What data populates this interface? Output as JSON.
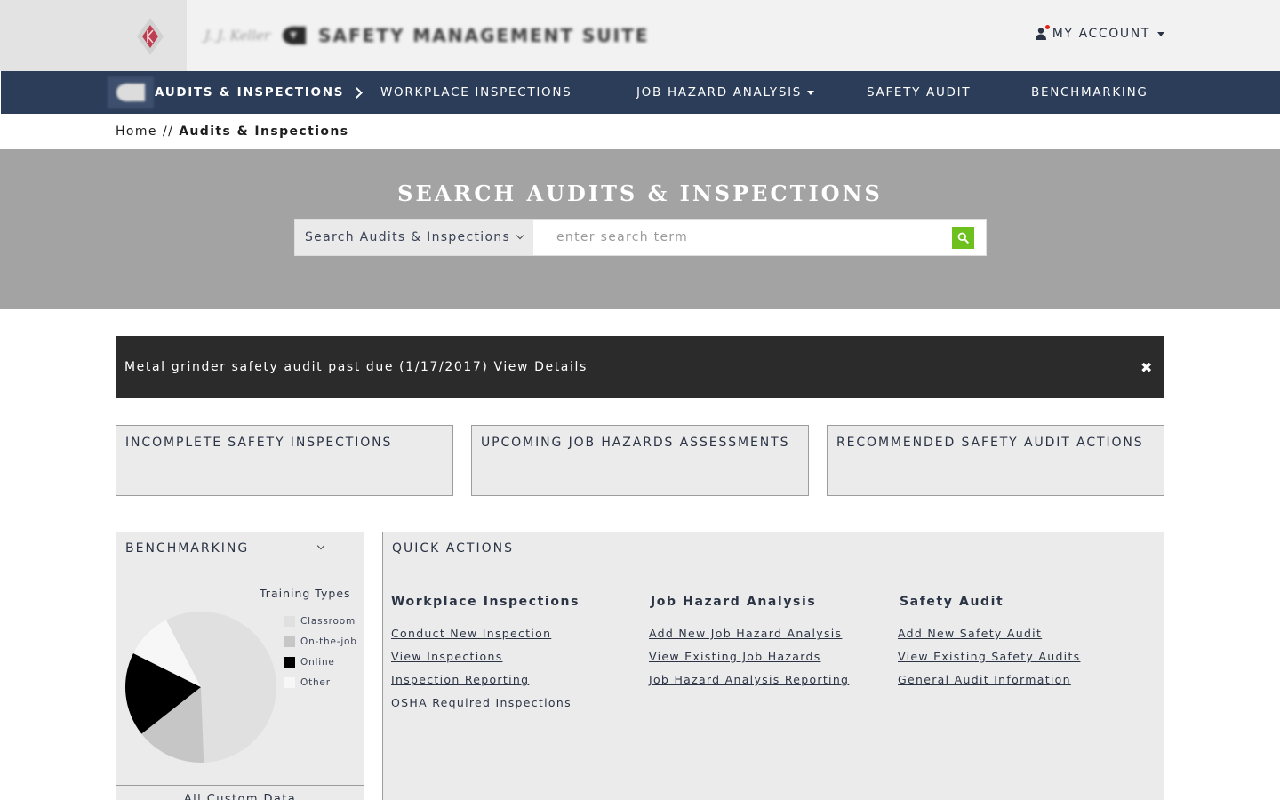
{
  "header": {
    "brand_small": "J. J. Keller",
    "brand_title": "SAFETY MANAGEMENT SUITE",
    "account_label": "MY ACCOUNT",
    "icons": {
      "logo": "kk-shield-logo",
      "brand": "brand-mark-icon",
      "account": "user-icon"
    }
  },
  "nav": {
    "items": [
      {
        "label": "AUDITS & INSPECTIONS",
        "active": true
      },
      {
        "label": "WORKPLACE INSPECTIONS"
      },
      {
        "label": "JOB HAZARD ANALYSIS",
        "dropdown": true
      },
      {
        "label": "SAFETY AUDIT"
      },
      {
        "label": "BENCHMARKING"
      }
    ],
    "color": "#2b3d59"
  },
  "breadcrumb": {
    "home": "Home",
    "separator": "//",
    "current": "Audits & Inspections"
  },
  "search": {
    "title": "SEARCH AUDITS & INSPECTIONS",
    "scope_value": "Search Audits & Inspections",
    "placeholder": "enter search term",
    "button_color": "#6dc01d"
  },
  "alert": {
    "message": "Metal grinder safety audit past due (1/17/2017)",
    "link": "View Details",
    "close": "✖"
  },
  "panels": [
    {
      "title": "INCOMPLETE SAFETY INSPECTIONS"
    },
    {
      "title": "UPCOMING JOB HAZARDS ASSESSMENTS"
    },
    {
      "title": "RECOMMENDED SAFETY AUDIT ACTIONS"
    }
  ],
  "benchmarking": {
    "title": "BENCHMARKING",
    "footer": "All Custom Data",
    "chart_data": {
      "type": "pie",
      "title": "Training Types",
      "legend_position": "right",
      "categories": [
        "Classroom",
        "On-the-job",
        "Online",
        "Other"
      ],
      "values": [
        57,
        15,
        18,
        10
      ],
      "colors": [
        "#e0e0e0",
        "#c6c6c6",
        "#000000",
        "#f7f7f7"
      ]
    }
  },
  "quick_actions": {
    "title": "QUICK ACTIONS",
    "columns": [
      {
        "title": "Workplace Inspections",
        "links": [
          "Conduct New Inspection",
          "View Inspections",
          "Inspection Reporting",
          "OSHA Required Inspections"
        ]
      },
      {
        "title": "Job Hazard Analysis",
        "links": [
          "Add New Job Hazard Analysis",
          "View Existing Job Hazards",
          "Job Hazard Analysis Reporting"
        ]
      },
      {
        "title": "Safety Audit",
        "links": [
          "Add New Safety Audit",
          "View Existing Safety Audits",
          "General Audit Information"
        ]
      }
    ]
  }
}
